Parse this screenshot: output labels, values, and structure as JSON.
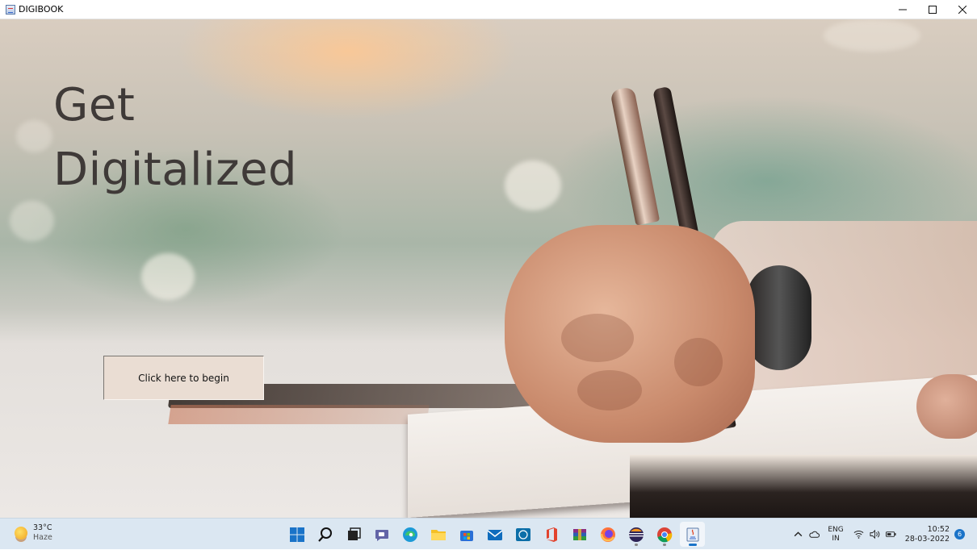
{
  "window": {
    "title": "DIGIBOOK",
    "controls": {
      "minimize_icon": "minimize-icon",
      "maximize_icon": "maximize-icon",
      "close_icon": "close-icon"
    }
  },
  "hero": {
    "headline_line1": "Get",
    "headline_line2": "Digitalized",
    "begin_button": "Click here to begin",
    "headline_color": "#3f3a38",
    "button_color": "#eaddd3"
  },
  "taskbar": {
    "weather": {
      "temperature": "33°C",
      "condition": "Haze",
      "icon": "sun-haze-icon"
    },
    "apps": [
      {
        "name": "start-button",
        "icon": "windows-start-icon",
        "running": false
      },
      {
        "name": "search-button",
        "icon": "search-icon",
        "running": false
      },
      {
        "name": "task-view-button",
        "icon": "task-view-icon",
        "running": false
      },
      {
        "name": "teams-chat-button",
        "icon": "chat-icon",
        "running": false
      },
      {
        "name": "edge-app",
        "icon": "edge-icon",
        "running": false
      },
      {
        "name": "file-explorer-app",
        "icon": "folder-icon",
        "running": false
      },
      {
        "name": "store-app",
        "icon": "store-icon",
        "running": false
      },
      {
        "name": "mail-app",
        "icon": "mail-icon",
        "running": false
      },
      {
        "name": "dell-app",
        "icon": "dell-icon",
        "running": false
      },
      {
        "name": "office-app",
        "icon": "office-icon",
        "running": false
      },
      {
        "name": "winrar-app",
        "icon": "winrar-icon",
        "running": false
      },
      {
        "name": "firefox-app",
        "icon": "firefox-icon",
        "running": false
      },
      {
        "name": "eclipse-app",
        "icon": "eclipse-icon",
        "running": true
      },
      {
        "name": "chrome-app",
        "icon": "chrome-icon",
        "running": true
      },
      {
        "name": "java-app",
        "icon": "java-icon",
        "running": true,
        "active": true
      }
    ],
    "tray": {
      "language_line1": "ENG",
      "language_line2": "IN",
      "time": "10:52",
      "date": "28-03-2022",
      "notification_count": "6"
    }
  }
}
